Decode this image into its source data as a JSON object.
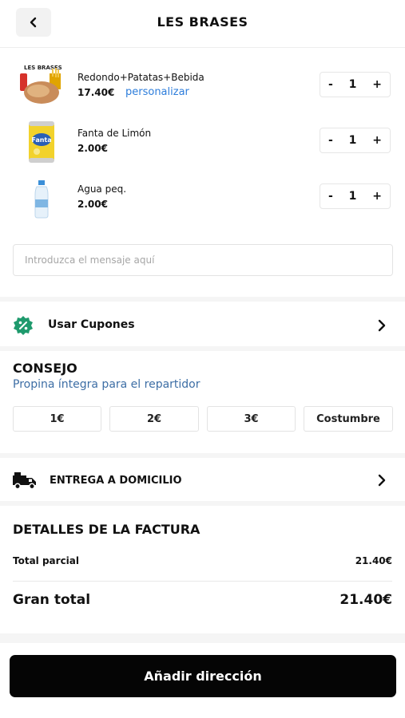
{
  "header": {
    "title": "LES BRASES"
  },
  "cart": {
    "items": [
      {
        "name": "Redondo+Patatas+Bebida",
        "price": "17.40€",
        "customize_label": "personalizar",
        "qty": "1",
        "minus": "-",
        "plus": "+",
        "image_text": "LES BRASES"
      },
      {
        "name": "Fanta de Limón",
        "price": "2.00€",
        "qty": "1",
        "minus": "-",
        "plus": "+",
        "image_text": "Fanta"
      },
      {
        "name": "Agua peq.",
        "price": "2.00€",
        "qty": "1",
        "minus": "-",
        "plus": "+"
      }
    ]
  },
  "message": {
    "placeholder": "Introduzca el mensaje aquí"
  },
  "coupons": {
    "label": "Usar Cupones"
  },
  "tip": {
    "title": "CONSEJO",
    "subtitle": "Propina íntegra para el repartidor",
    "options": [
      "1€",
      "2€",
      "3€",
      "Costumbre"
    ]
  },
  "delivery": {
    "label": "ENTREGA A DOMICILIO"
  },
  "bill": {
    "title": "DETALLES DE LA FACTURA",
    "subtotal_label": "Total parcial",
    "subtotal_value": "21.40€",
    "total_label": "Gran total",
    "total_value": "21.40€"
  },
  "cta": {
    "label": "Añadir dirección"
  },
  "colors": {
    "link_blue": "#2d7ddb",
    "coupon_green": "#1f9a6d",
    "subtitle_blue": "#3d6ea5",
    "cta_black": "#050505"
  }
}
